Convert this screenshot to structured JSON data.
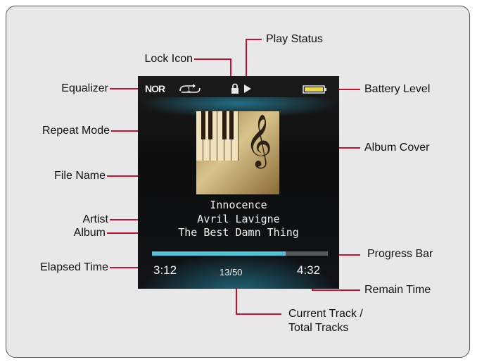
{
  "labels": {
    "play_status": "Play Status",
    "lock_icon": "Lock Icon",
    "equalizer": "Equalizer",
    "battery_level": "Battery Level",
    "repeat_mode": "Repeat Mode",
    "album_cover": "Album Cover",
    "file_name": "File Name",
    "artist": "Artist",
    "album": "Album",
    "progress_bar": "Progress Bar",
    "elapsed_time": "Elapsed Time",
    "remain_time": "Remain Time",
    "current_track_line1": "Current Track /",
    "current_track_line2": "Total Tracks"
  },
  "screen": {
    "equalizer_mode": "NOR",
    "repeat_glyph": "1",
    "file_name": "Innocence",
    "artist": "Avril Lavigne",
    "album": "The Best Damn Thing",
    "elapsed": "3:12",
    "track_count": "13/50",
    "remain": "4:32",
    "progress_fraction": 0.76
  },
  "icons": [
    "repeat-icon",
    "lock-icon",
    "play-icon",
    "battery-icon",
    "album-cover-image"
  ],
  "colors": {
    "panel_bg": "#e8e8e8",
    "progress_fill": "#4ec3da",
    "battery_fill": "#e8d84a"
  }
}
